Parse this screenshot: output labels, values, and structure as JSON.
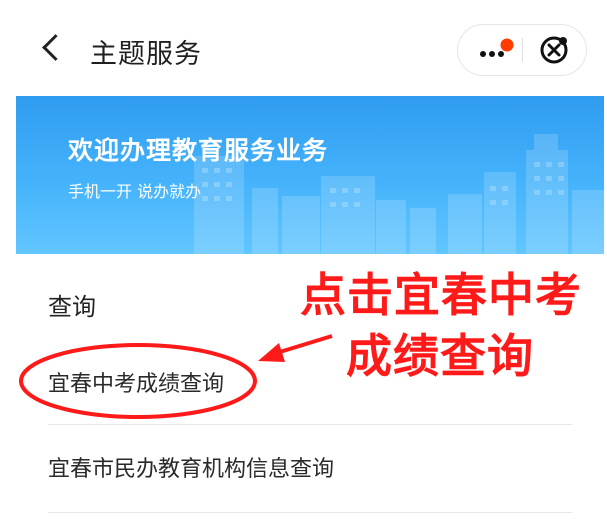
{
  "header": {
    "title": "主题服务",
    "back_icon": "chevron-left-icon",
    "more_icon": "more-dots-icon",
    "close_icon": "mini-program-close-icon",
    "badge_color": "#ff3b00"
  },
  "banner": {
    "title": "欢迎办理教育服务业务",
    "subtitle": "手机一开 说办就办",
    "colors": {
      "top": "#2f9cf0",
      "bottom": "#62c6ff"
    }
  },
  "section": {
    "title": "查询",
    "items": [
      {
        "label": "宜春中考成绩查询"
      },
      {
        "label": "宜春市民办教育机构信息查询"
      }
    ]
  },
  "annotation": {
    "line1": "点击宜春中考",
    "line2": "成绩查询",
    "color": "#ff1a1a"
  }
}
